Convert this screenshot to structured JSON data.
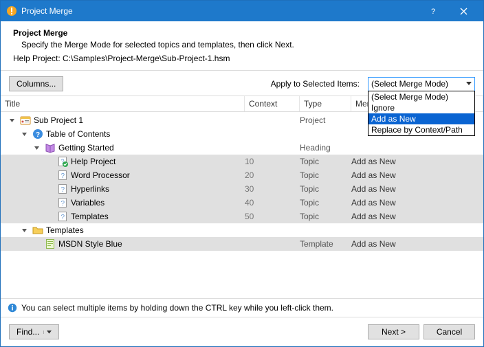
{
  "window": {
    "title": "Project Merge"
  },
  "header": {
    "title": "Project Merge",
    "subtitle": "Specify the Merge Mode for selected topics and templates, then click Next.",
    "path_label": "Help Project:",
    "path_value": "C:\\Samples\\Project-Merge\\Sub-Project-1.hsm"
  },
  "toolbar": {
    "columns_label": "Columns...",
    "apply_label": "Apply to Selected Items:",
    "combo_value": "(Select Merge Mode)",
    "options": [
      "(Select Merge Mode)",
      "Ignore",
      "Add as New",
      "Replace by Context/Path"
    ],
    "selected_index": 2
  },
  "columns": {
    "title": "Title",
    "context": "Context",
    "type": "Type",
    "merge": "Merge Mode"
  },
  "rows": [
    {
      "indent": 0,
      "exp": "v",
      "icon": "project",
      "title": "Sub Project 1",
      "ctx": "",
      "type": "Project",
      "mm": "",
      "sel": false
    },
    {
      "indent": 1,
      "exp": "v",
      "icon": "toc",
      "title": "Table of Contents",
      "ctx": "",
      "type": "",
      "mm": "",
      "sel": false
    },
    {
      "indent": 2,
      "exp": "v",
      "icon": "book",
      "title": "Getting Started",
      "ctx": "",
      "type": "Heading",
      "mm": "",
      "sel": false
    },
    {
      "indent": 3,
      "exp": "",
      "icon": "topic-check",
      "title": "Help Project",
      "ctx": "10",
      "type": "Topic",
      "mm": "Add as New",
      "sel": true
    },
    {
      "indent": 3,
      "exp": "",
      "icon": "topic",
      "title": "Word Processor",
      "ctx": "20",
      "type": "Topic",
      "mm": "Add as New",
      "sel": true
    },
    {
      "indent": 3,
      "exp": "",
      "icon": "topic",
      "title": "Hyperlinks",
      "ctx": "30",
      "type": "Topic",
      "mm": "Add as New",
      "sel": true
    },
    {
      "indent": 3,
      "exp": "",
      "icon": "topic",
      "title": "Variables",
      "ctx": "40",
      "type": "Topic",
      "mm": "Add as New",
      "sel": true
    },
    {
      "indent": 3,
      "exp": "",
      "icon": "topic",
      "title": "Templates",
      "ctx": "50",
      "type": "Topic",
      "mm": "Add as New",
      "sel": true
    },
    {
      "indent": 1,
      "exp": "v",
      "icon": "folder",
      "title": "Templates",
      "ctx": "",
      "type": "",
      "mm": "",
      "sel": false
    },
    {
      "indent": 2,
      "exp": "",
      "icon": "template",
      "title": "MSDN Style Blue",
      "ctx": "",
      "type": "Template",
      "mm": "Add as New",
      "sel": true
    }
  ],
  "hint": {
    "text": "You can select multiple items by holding down the CTRL key while you left-click them."
  },
  "footer": {
    "find_label": "Find...",
    "next_label": "Next >",
    "cancel_label": "Cancel"
  }
}
